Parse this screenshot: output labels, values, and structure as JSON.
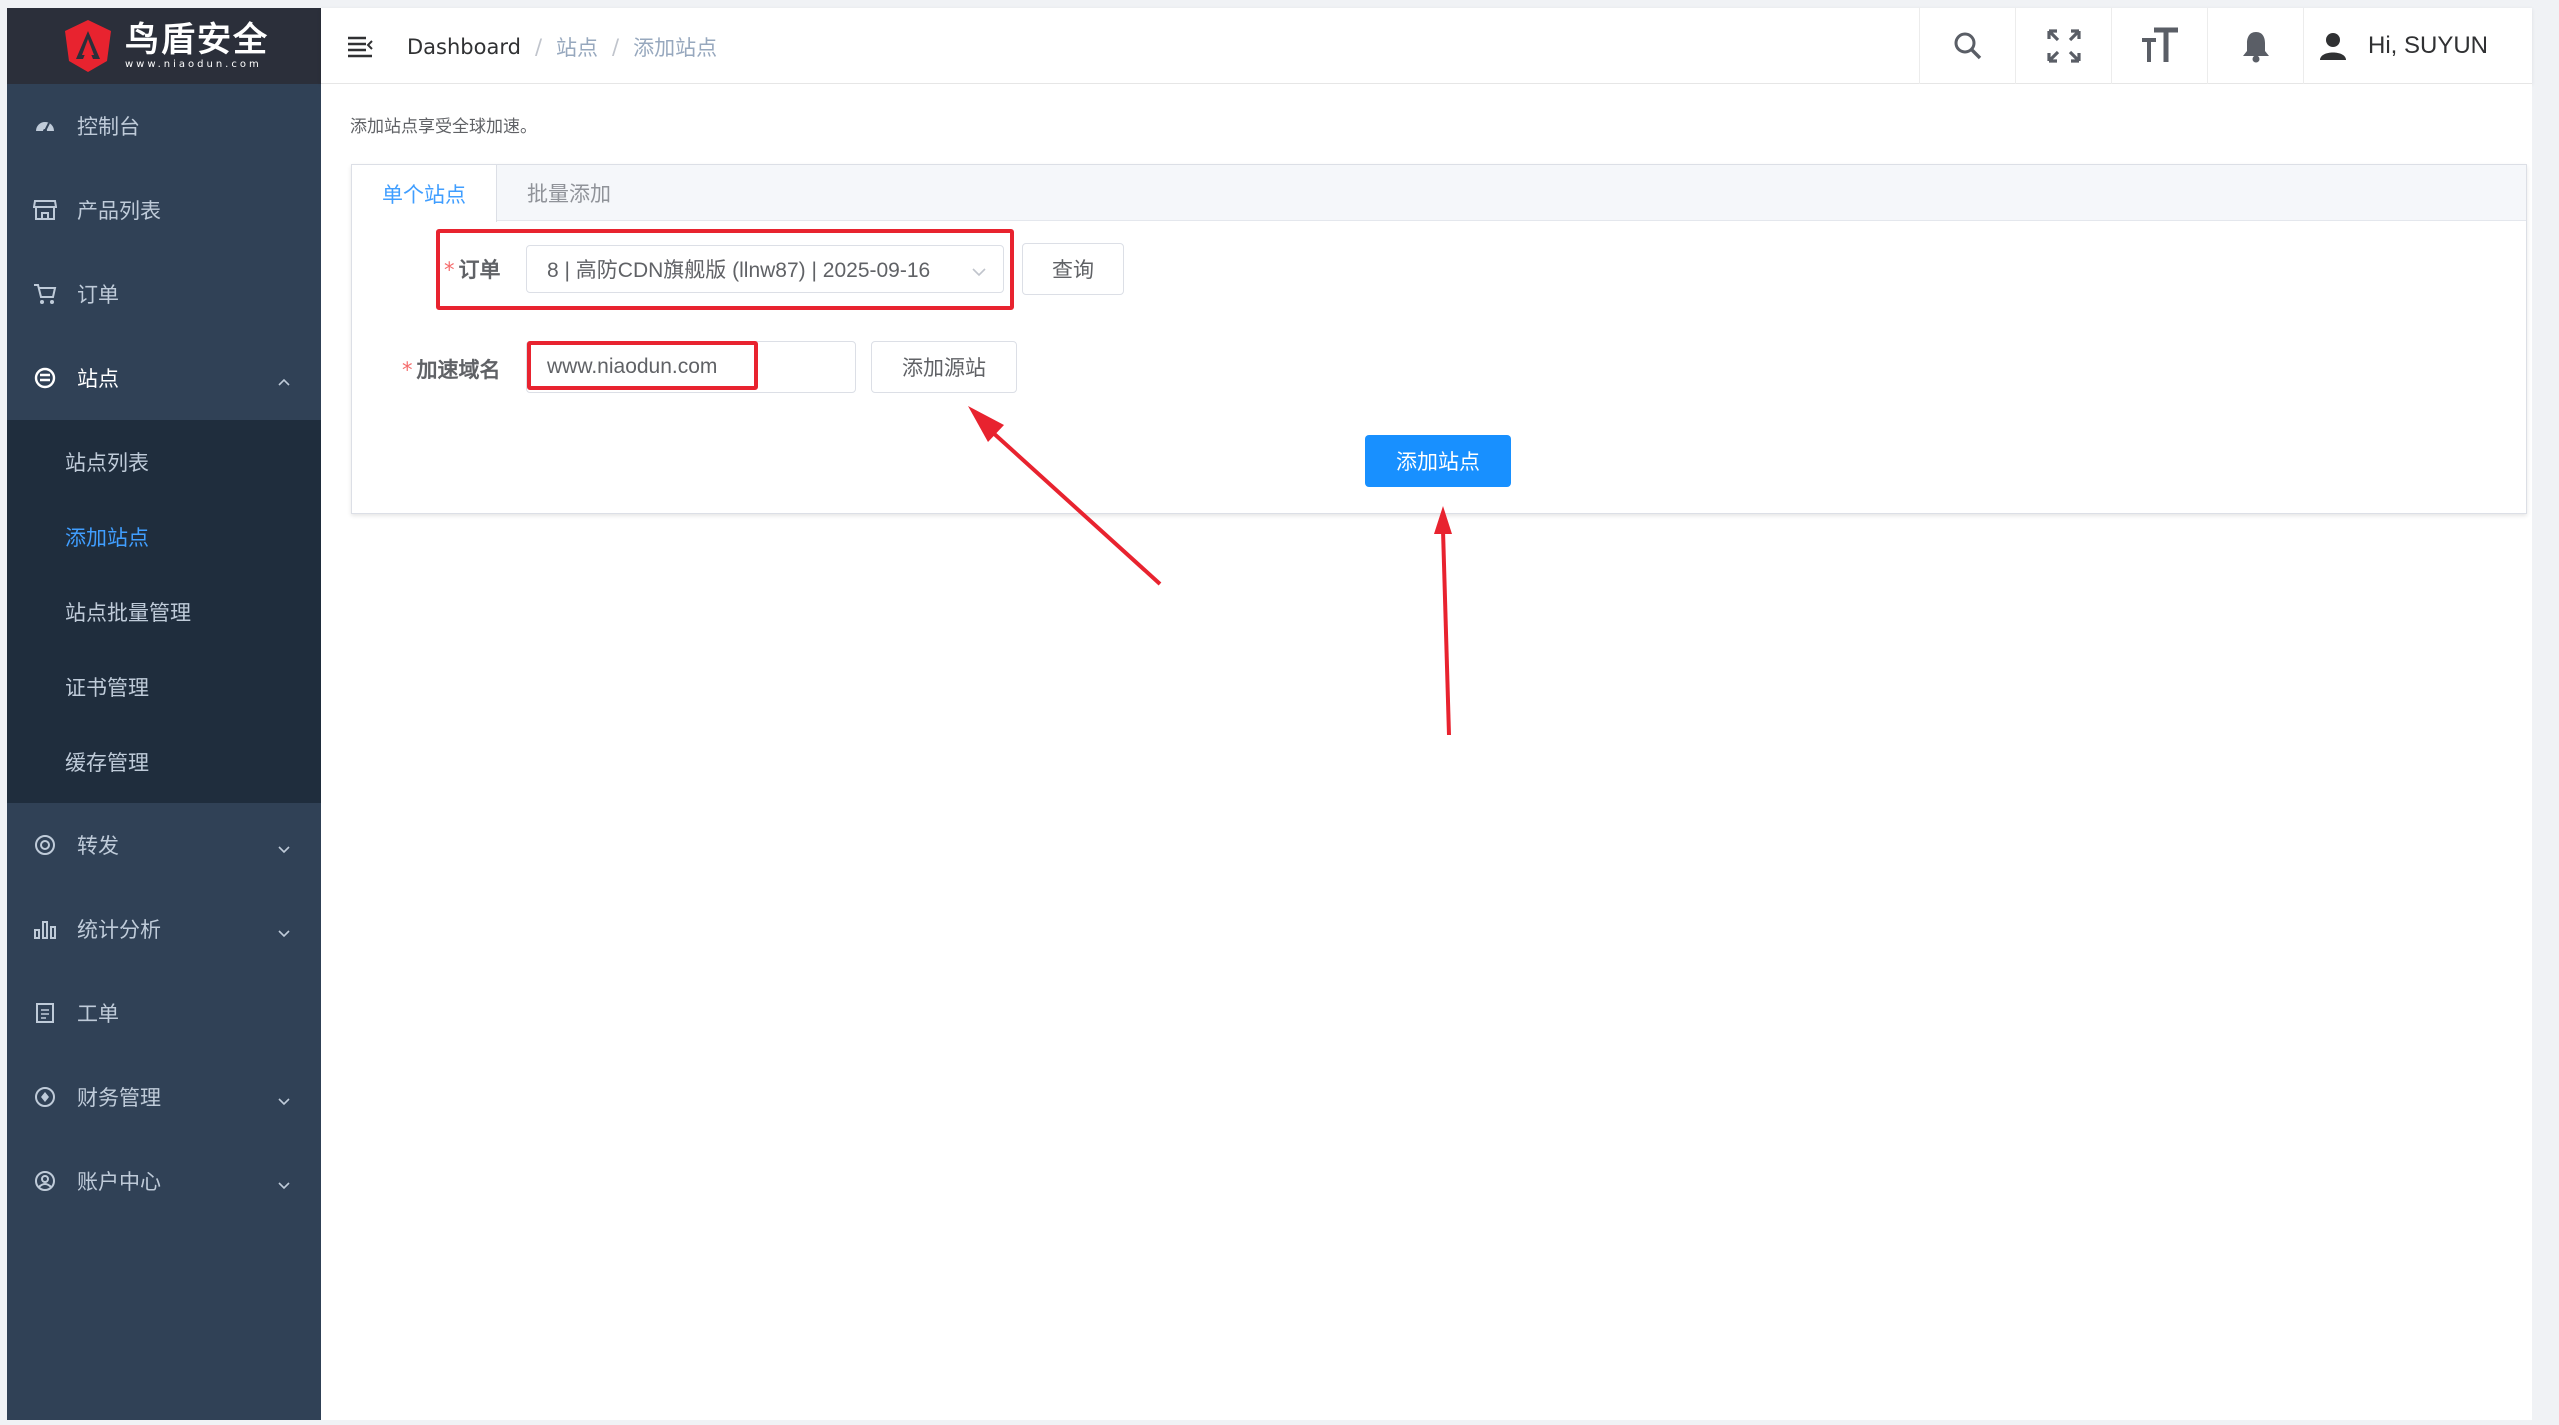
{
  "app": {
    "logo_title": "鸟盾安全",
    "logo_sub": "www.niaodun.com"
  },
  "sidebar": {
    "items": [
      {
        "label": "控制台",
        "icon": "dashboard-icon"
      },
      {
        "label": "产品列表",
        "icon": "store-icon"
      },
      {
        "label": "订单",
        "icon": "cart-icon"
      },
      {
        "label": "站点",
        "icon": "site-icon",
        "expanded": true
      },
      {
        "label": "转发",
        "icon": "forward-icon"
      },
      {
        "label": "统计分析",
        "icon": "chart-bar-icon"
      },
      {
        "label": "工单",
        "icon": "ticket-icon"
      },
      {
        "label": "财务管理",
        "icon": "finance-icon"
      },
      {
        "label": "账户中心",
        "icon": "account-icon"
      }
    ],
    "sub_items": [
      {
        "label": "站点列表"
      },
      {
        "label": "添加站点",
        "active": true
      },
      {
        "label": "站点批量管理"
      },
      {
        "label": "证书管理"
      },
      {
        "label": "缓存管理"
      }
    ]
  },
  "header": {
    "breadcrumb": [
      "Dashboard",
      "站点",
      "添加站点"
    ],
    "greeting": "Hi, SUYUN"
  },
  "main": {
    "intro": "添加站点享受全球加速。",
    "tabs": [
      {
        "label": "单个站点",
        "active": true
      },
      {
        "label": "批量添加"
      }
    ],
    "form": {
      "order_label": "订单",
      "order_value": "8 | 高防CDN旗舰版 (llnw87)  | 2025-09-16",
      "query_button": "查询",
      "domain_label": "加速域名",
      "domain_value": "www.niaodun.com",
      "add_origin_button": "添加源站",
      "submit_button": "添加站点"
    }
  },
  "colors": {
    "sidebar_bg": "#304156",
    "submenu_bg": "#1f2d3d",
    "accent": "#1890ff",
    "annotation": "#e8232f"
  }
}
